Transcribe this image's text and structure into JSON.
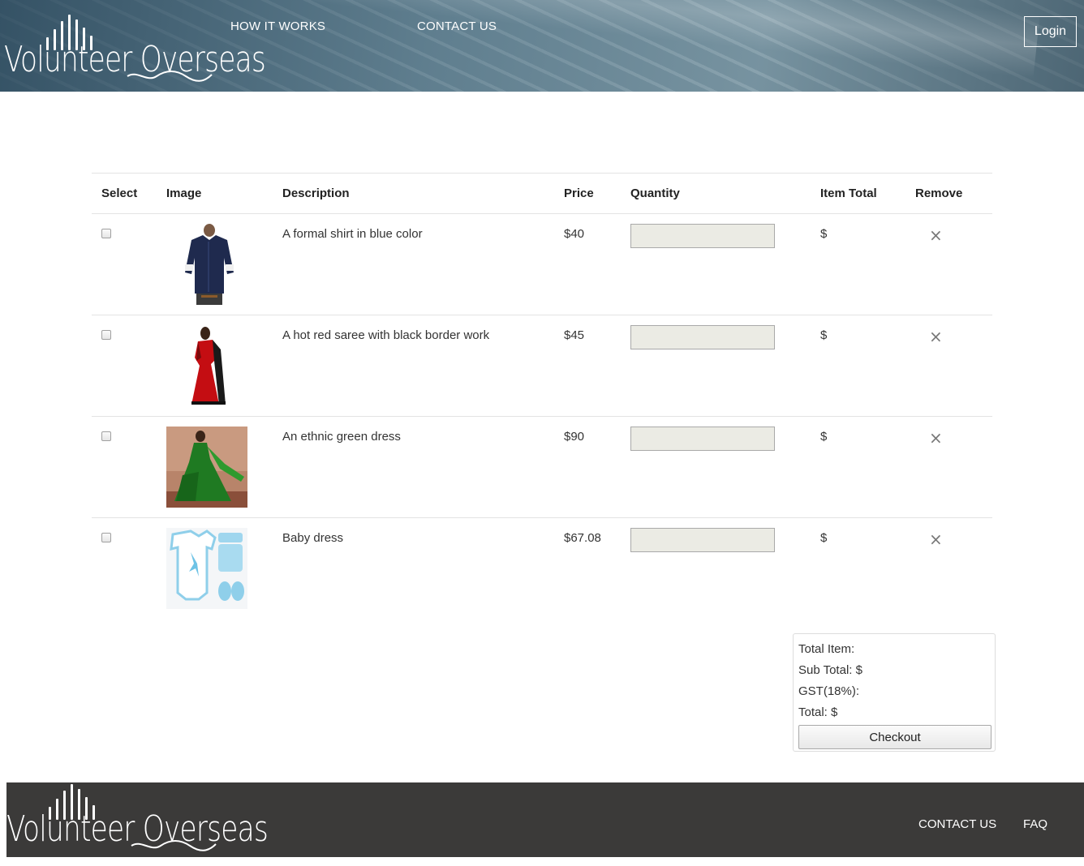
{
  "header": {
    "logo_text": "Volunteer Overseas",
    "nav": {
      "how_it_works": "HOW IT WORKS",
      "contact_us": "CONTACT US"
    },
    "login_label": "Login"
  },
  "cart": {
    "columns": {
      "select": "Select",
      "image": "Image",
      "description": "Description",
      "price": "Price",
      "quantity": "Quantity",
      "item_total": "Item Total",
      "remove": "Remove"
    },
    "rows": [
      {
        "description": "A formal shirt in blue color",
        "price": "$40",
        "quantity": "",
        "item_total": "$",
        "image_icon": "blue-shirt-image"
      },
      {
        "description": "A hot red saree with black border work",
        "price": "$45",
        "quantity": "",
        "item_total": "$",
        "image_icon": "red-saree-image"
      },
      {
        "description": "An ethnic green dress",
        "price": "$90",
        "quantity": "",
        "item_total": "$",
        "image_icon": "green-dress-image"
      },
      {
        "description": "Baby dress",
        "price": "$67.08",
        "quantity": "",
        "item_total": "$",
        "image_icon": "baby-dress-image"
      }
    ],
    "remove_glyph": "×"
  },
  "summary": {
    "total_item": "Total Item:",
    "sub_total": "Sub Total: $",
    "gst": "GST(18%):",
    "total": "Total: $",
    "checkout_label": "Checkout"
  },
  "footer": {
    "logo_text": "Volunteer Overseas",
    "links": {
      "contact_us": "CONTACT US",
      "faq": "FAQ"
    }
  },
  "colors": {
    "footer_bg": "#3b3a39",
    "header_tint": "#4b6b7c",
    "input_bg": "#ebebe4"
  }
}
